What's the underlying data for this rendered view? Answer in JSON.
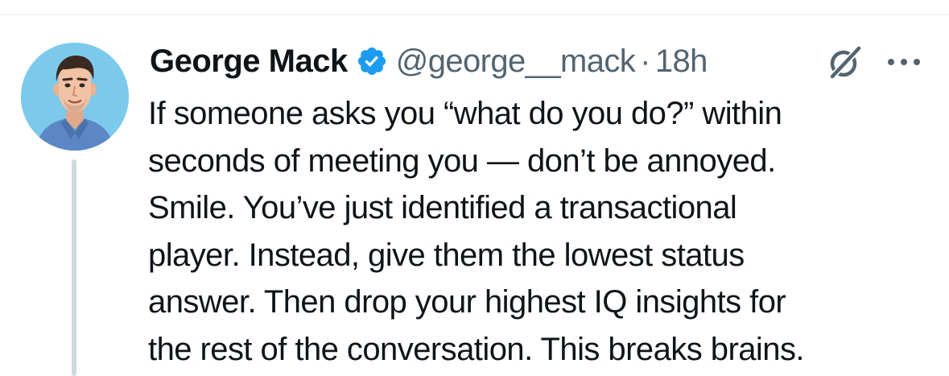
{
  "tweet": {
    "author": {
      "display_name": "George Mack",
      "handle": "@george__mack",
      "verified_icon": "verified-badge-icon",
      "avatar": "avatar"
    },
    "separator": "·",
    "time": "18h",
    "actions": {
      "grok_icon": "grok-icon",
      "more_icon": "more-icon"
    },
    "text_lines": [
      "If someone asks you “what do you do?” within",
      "seconds of meeting you — don’t be annoyed.",
      "Smile. You’ve just identified a transactional",
      "player. Instead, give them the lowest status",
      "answer. Then drop your highest IQ insights for",
      "the rest of the conversation. This breaks brains."
    ]
  },
  "colors": {
    "text_primary": "#0f1419",
    "text_secondary": "#536471",
    "verified_blue": "#1d9bf0",
    "avatar_background": "#7cc9ec",
    "thread_line": "#cfd9de",
    "divider": "#eff3f4"
  }
}
